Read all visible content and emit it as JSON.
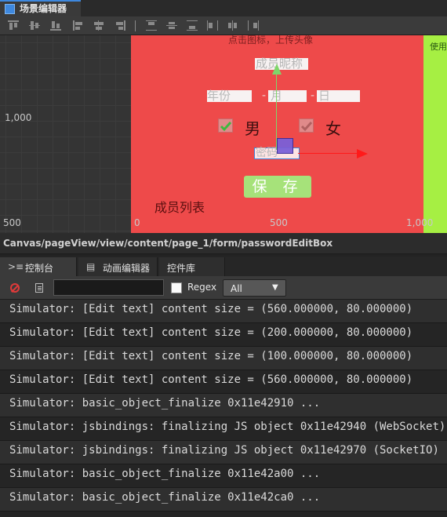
{
  "scene_tab": {
    "label": "场景编辑器",
    "icon": "scene-icon"
  },
  "align_toolbar": {
    "icons": [
      "align-top-icon",
      "align-vcenter-icon",
      "align-bottom-icon",
      "align-left-icon",
      "align-hcenter-icon",
      "align-right-icon",
      "distribute-top-icon",
      "distribute-vcenter-icon",
      "distribute-bottom-icon",
      "distribute-left-icon",
      "distribute-hcenter-icon",
      "distribute-right-icon"
    ]
  },
  "viewport": {
    "ruler": {
      "y_1000": "1,000",
      "y_500": "500",
      "x_0": "0",
      "x_500": "500",
      "x_1000": "1,000"
    },
    "canvas": {
      "upload_hint": "点击图标，上传头像",
      "nickname": "成员昵称",
      "year": "年份",
      "month": "月",
      "day": "日",
      "dash1": "-",
      "dash2": "-",
      "male": "男",
      "female": "女",
      "password": "密码",
      "save": "保 存",
      "member_list": "成员列表"
    },
    "side_label": "使用",
    "colors": {
      "canvas_bg": "#ee4a4a",
      "side_bg": "#a6ef43",
      "save_btn": "#a6e27a"
    }
  },
  "path": "Canvas/pageView/view/content/page_1/form/passwordEditBox",
  "panel_tabs": [
    {
      "label": "控制台",
      "icon": "console-icon"
    },
    {
      "label": "动画编辑器",
      "icon": "animation-icon"
    },
    {
      "label": "控件库",
      "icon": ""
    }
  ],
  "console_toolbar": {
    "filter_value": "",
    "regex_label": "Regex",
    "level_value": "All",
    "level_arrow": "▼"
  },
  "logs": [
    "Simulator: [Edit text] content size = (560.000000, 80.000000)",
    "Simulator: [Edit text] content size = (200.000000, 80.000000)",
    "Simulator: [Edit text] content size = (100.000000, 80.000000)",
    "Simulator: [Edit text] content size = (560.000000, 80.000000)",
    "Simulator: basic_object_finalize 0x11e42910 ...",
    "Simulator: jsbindings: finalizing JS object 0x11e42940 (WebSocket)",
    "Simulator: jsbindings: finalizing JS object 0x11e42970 (SocketIO)",
    "Simulator: basic_object_finalize 0x11e42a00 ...",
    "Simulator: basic_object_finalize 0x11e42ca0 ..."
  ]
}
